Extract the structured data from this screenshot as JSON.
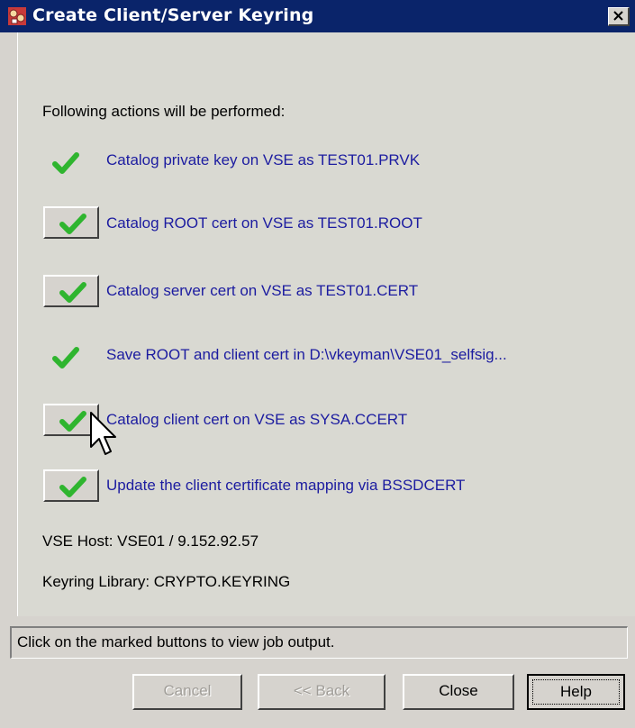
{
  "window": {
    "title": "Create Client/Server Keyring",
    "close_label": "×"
  },
  "heading": "Following actions will be performed:",
  "actions": [
    {
      "label": "Catalog private key on VSE as TEST01.PRVK",
      "has_button": false
    },
    {
      "label": "Catalog ROOT cert on VSE as TEST01.ROOT",
      "has_button": true
    },
    {
      "label": "Catalog server cert on VSE as TEST01.CERT",
      "has_button": true
    },
    {
      "label": "Save ROOT and client cert in D:\\vkeyman\\VSE01_selfsig...",
      "has_button": false
    },
    {
      "label": "Catalog client cert on VSE as SYSA.CCERT",
      "has_button": true
    },
    {
      "label": "Update the client certificate mapping via BSSDCERT",
      "has_button": true
    }
  ],
  "info": {
    "vse_host": "VSE Host: VSE01 / 9.152.92.57",
    "keyring_library": "Keyring Library: CRYPTO.KEYRING"
  },
  "status_text": "Click on the marked buttons to view job output.",
  "buttons": {
    "cancel": "Cancel",
    "back": "<< Back",
    "close": "Close",
    "help": "Help"
  },
  "icons": {
    "check": "green-checkmark-icon",
    "app": "keyring-app-icon",
    "cursor": "arrow-cursor-icon"
  },
  "colors": {
    "titlebar": "#0a246a",
    "action_text": "#1c1ca0",
    "check_green": "#2fb52f"
  }
}
